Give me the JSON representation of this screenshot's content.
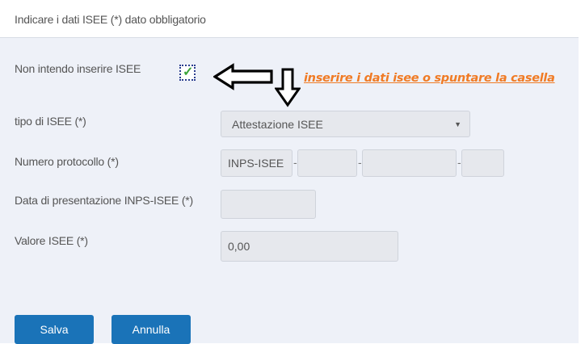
{
  "header": {
    "title": "Indicare i dati ISEE (*) dato obbligatorio"
  },
  "opt_out": {
    "label": "Non intendo inserire ISEE",
    "checked": true
  },
  "annotation": {
    "text": "inserire i dati isee o spuntare la casella",
    "color": "#f07b25"
  },
  "tipo": {
    "label": "tipo di ISEE (*)",
    "selected": "Attestazione ISEE"
  },
  "protocollo": {
    "label": "Numero protocollo (*)",
    "prefix": "INPS-ISEE",
    "separator": "-"
  },
  "data_presentazione": {
    "label": "Data di presentazione INPS-ISEE (*)",
    "value": ""
  },
  "valore": {
    "label": "Valore ISEE (*)",
    "value": "0,00"
  },
  "buttons": {
    "save": "Salva",
    "cancel": "Annulla"
  },
  "colors": {
    "accent": "#1a73b8",
    "panel_bg": "#eef1f8",
    "field_bg": "#e6e8ed"
  }
}
